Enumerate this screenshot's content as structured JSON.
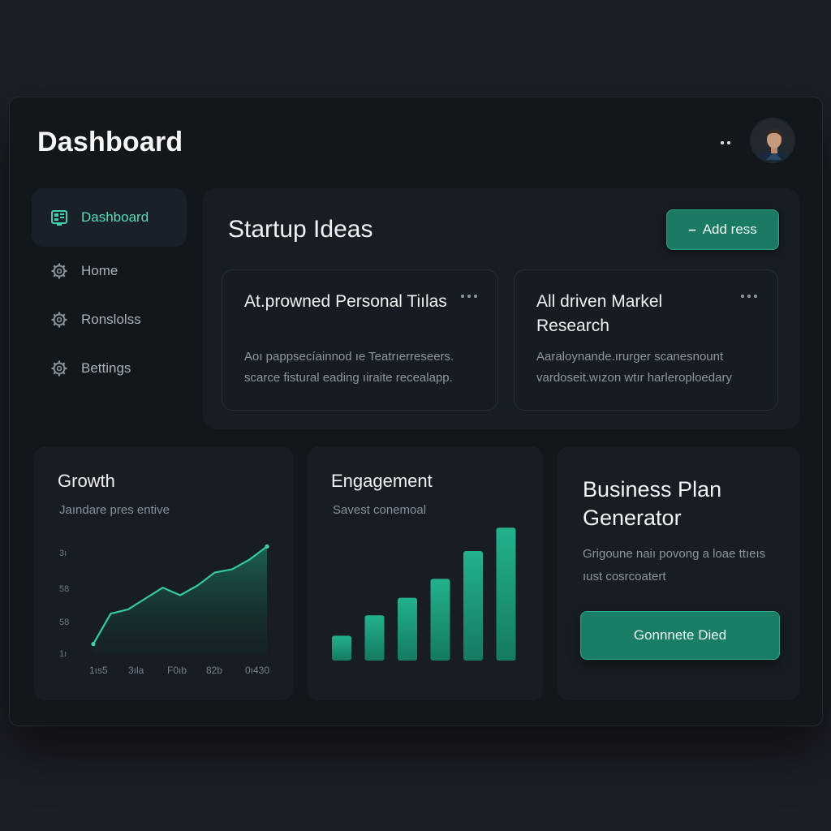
{
  "header": {
    "title": "Dashboard"
  },
  "sidebar": {
    "items": [
      {
        "label": "Dashboard",
        "icon": "dashboard-icon",
        "active": true
      },
      {
        "label": "Home",
        "icon": "gear-icon"
      },
      {
        "label": "Ronslolss",
        "icon": "gear-icon"
      },
      {
        "label": "Bettings",
        "icon": "gear-icon"
      }
    ]
  },
  "ideas": {
    "title": "Startup Ideas",
    "add_label": "Add ress",
    "cards": [
      {
        "title": "At.prowned Personal Tiılas",
        "desc": "Aoı pappsecíainnod ıe Teatrıerreseers. scarce fistural eading ıiraite recealapp."
      },
      {
        "title": "All driven Markel Research",
        "desc": "Aaraloynande.ırurger scanesnount vardoseit.wızon wtır harleroploedary"
      }
    ]
  },
  "growth": {
    "title": "Growth",
    "subtitle": "Jaındare pres entive"
  },
  "engagement": {
    "title": "Engagement",
    "subtitle": "Savest conemoal"
  },
  "plan": {
    "title": "Business Plan Generator",
    "desc": "Grigoune naiı povong a loae ttıeıs ıust cosrcoatert",
    "button_label": "Gonnnete Died"
  },
  "colors": {
    "accent": "#2fb58f",
    "accent_dark": "#1b7a64",
    "active_nav": "#43d4b0"
  },
  "chart_data": [
    {
      "type": "area",
      "title": "Growth",
      "subtitle": "Jaındare pres entive",
      "x": [
        "1ıs5",
        "3ıla",
        "F0ıb",
        "82b",
        "0ı430"
      ],
      "yticks": [
        "3ı",
        "58",
        "58",
        "1ı"
      ],
      "series": [
        {
          "values": [
            10,
            38,
            42,
            52,
            62,
            55,
            64,
            76,
            79,
            88,
            100
          ]
        }
      ],
      "ylim": [
        0,
        110
      ],
      "grid": false
    },
    {
      "type": "bar",
      "title": "Engagement",
      "subtitle": "Savest conemoal",
      "categories": [
        "",
        "",
        "",
        "",
        "",
        ""
      ],
      "values": [
        17,
        31,
        43,
        56,
        75,
        91
      ],
      "ylim": [
        0,
        100
      ],
      "grid": false
    }
  ]
}
